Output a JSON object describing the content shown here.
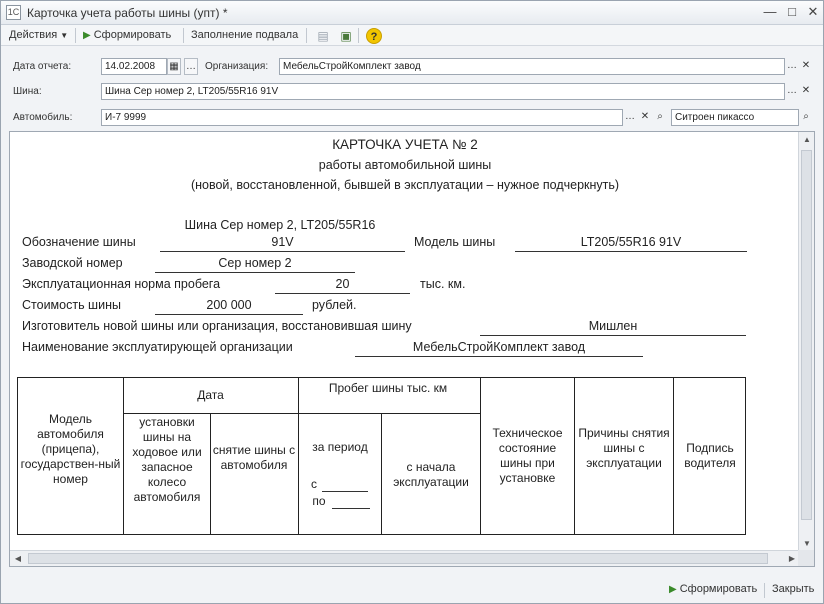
{
  "window": {
    "title": "Карточка учета работы шины (упт) *",
    "app_icon": "1C",
    "minimize": "—",
    "maximize": "□",
    "close": "✕"
  },
  "toolbar": {
    "actions_label": "Действия",
    "generate_label": "Сформировать",
    "fill_footer_label": "Заполнение подвала",
    "help_glyph": "?"
  },
  "form": {
    "date_label": "Дата отчета:",
    "date_value": "14.02.2008",
    "org_label": "Организация:",
    "org_value": "МебельСтройКомплект завод",
    "tire_label": "Шина:",
    "tire_value": "Шина Сер номер 2, LT205/55R16 91V",
    "car_label": "Автомобиль:",
    "car_value": "И-7 9999",
    "car_model_value": "Ситроен пикассо"
  },
  "report": {
    "title": "КАРТОЧКА УЧЕТА № 2",
    "subtitle1": "работы автомобильной шины",
    "subtitle2": "(новой, восстановленной, бывшей в эксплуатации – нужное подчеркнуть)",
    "designation_value_line1": "Шина Сер номер 2, LT205/55R16",
    "designation_label": "Обозначение шины",
    "designation_value_line2": "91V",
    "model_label": "Модель шины",
    "model_value": "LT205/55R16 91V",
    "serial_label": "Заводской номер",
    "serial_value": "Сер номер 2",
    "norm_label": "Эксплуатационная норма пробега",
    "norm_value": "20",
    "norm_unit": "тыс. км.",
    "cost_label": "Стоимость шины",
    "cost_value": "200 000",
    "cost_unit": "рублей.",
    "maker_label": "Изготовитель новой шины или организация, восстановившая шину",
    "maker_value": "Мишлен",
    "operator_label": "Наименование эксплуатирующей организации",
    "operator_value": "МебельСтройКомплект завод"
  },
  "table": {
    "col_model": "Модель автомобиля (прицепа), государствен-ный номер",
    "col_date": "Дата",
    "col_date_install": "установки шины на ходовое или запасное колесо автомобиля",
    "col_date_remove": "снятие шины с автомобиля",
    "col_mileage": "Пробег шины тыс. км",
    "col_mileage_period": "за период",
    "period_from": "с",
    "period_to": "по",
    "col_mileage_start": "с начала эксплуатации",
    "col_tech_state": "Техническое состояние шины при установке",
    "col_reasons": "Причины снятия шины с эксплуатации",
    "col_signature": "Подпись водителя"
  },
  "statusbar": {
    "generate_label": "Сформировать",
    "close_label": "Закрыть"
  }
}
